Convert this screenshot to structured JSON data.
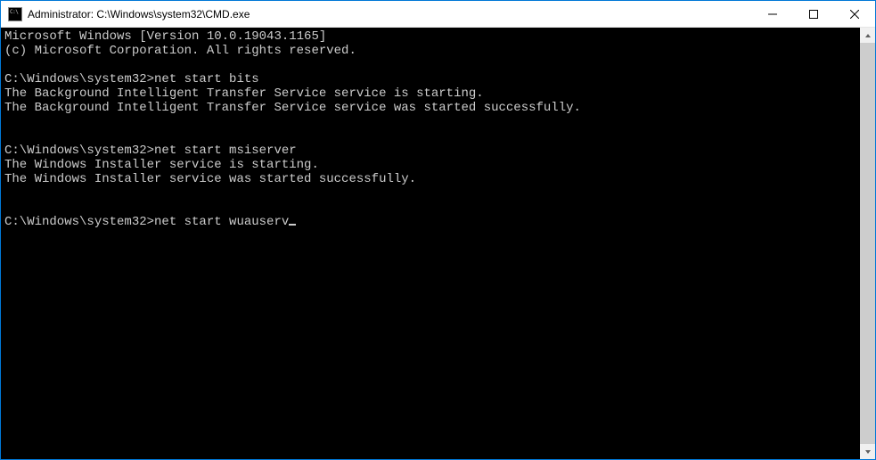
{
  "window": {
    "title": "Administrator: C:\\Windows\\system32\\CMD.exe"
  },
  "console": {
    "lines": [
      "Microsoft Windows [Version 10.0.19043.1165]",
      "(c) Microsoft Corporation. All rights reserved.",
      "",
      "C:\\Windows\\system32>net start bits",
      "The Background Intelligent Transfer Service service is starting.",
      "The Background Intelligent Transfer Service service was started successfully.",
      "",
      "",
      "C:\\Windows\\system32>net start msiserver",
      "The Windows Installer service is starting.",
      "The Windows Installer service was started successfully.",
      "",
      "",
      "C:\\Windows\\system32>net start wuauserv"
    ],
    "cursor_after_last": true
  }
}
